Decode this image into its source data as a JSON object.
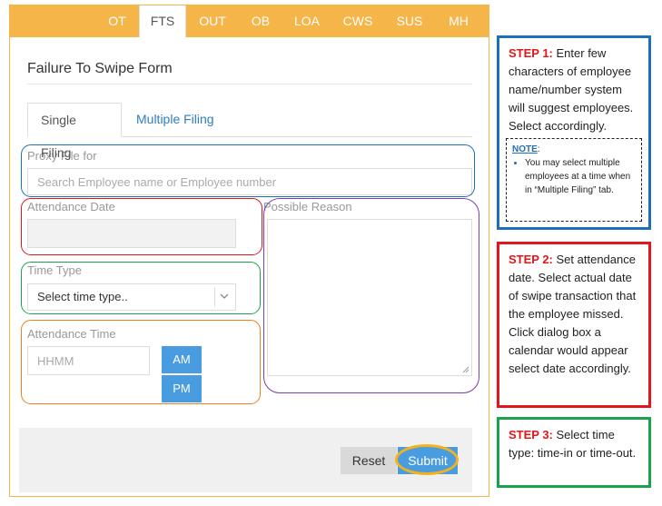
{
  "tabs": [
    {
      "label": "OT",
      "active": false
    },
    {
      "label": "FTS",
      "active": true
    },
    {
      "label": "OUT",
      "active": false
    },
    {
      "label": "OB",
      "active": false
    },
    {
      "label": "LOA",
      "active": false
    },
    {
      "label": "CWS",
      "active": false
    },
    {
      "label": "SUS",
      "active": false
    },
    {
      "label": "MH",
      "active": false
    }
  ],
  "form": {
    "title": "Failure To Swipe Form",
    "subtabs": {
      "single": "Single Filing",
      "multiple": "Multiple Filing"
    },
    "proxy": {
      "label": "Proxy File for",
      "placeholder": "Search Employee name or Employee number"
    },
    "attendance_date": {
      "label": "Attendance Date",
      "value": ""
    },
    "time_type": {
      "label": "Time Type",
      "selected": "Select time type.."
    },
    "attendance_time": {
      "label": "Attendance Time",
      "placeholder": "HHMM",
      "am": "AM",
      "pm": "PM"
    },
    "reason": {
      "label": "Possible Reason"
    },
    "buttons": {
      "reset": "Reset",
      "submit": "Submit"
    }
  },
  "steps": {
    "step1": {
      "label": "STEP 1:",
      "text": "Enter few characters of employee name/number system will suggest employees. Select accordingly.",
      "note_title": "NOTE",
      "note_text": "You may select multiple employees at a time when in “Multiple Filing” tab."
    },
    "step2": {
      "label": "STEP 2:",
      "text": "Set attendance date. Select actual date of swipe transaction that the employee missed. Click dialog box a calendar would appear select date accordingly."
    },
    "step3": {
      "label": "STEP 3:",
      "text": "Select time type: time-in or time-out."
    }
  },
  "colors": {
    "tab_bar": "#f6b548",
    "primary_button": "#4a9ce0",
    "step1_border": "#1f6fb8",
    "step2_border": "#e0161b",
    "step3_border": "#1aa34a",
    "time_outline": "#ef7d22",
    "reason_outline": "#7a3fb0",
    "submit_highlight": "#f2b21c"
  },
  "icons": {
    "select_arrow": "chevron-down-icon",
    "resize": "resize-grip-icon"
  }
}
